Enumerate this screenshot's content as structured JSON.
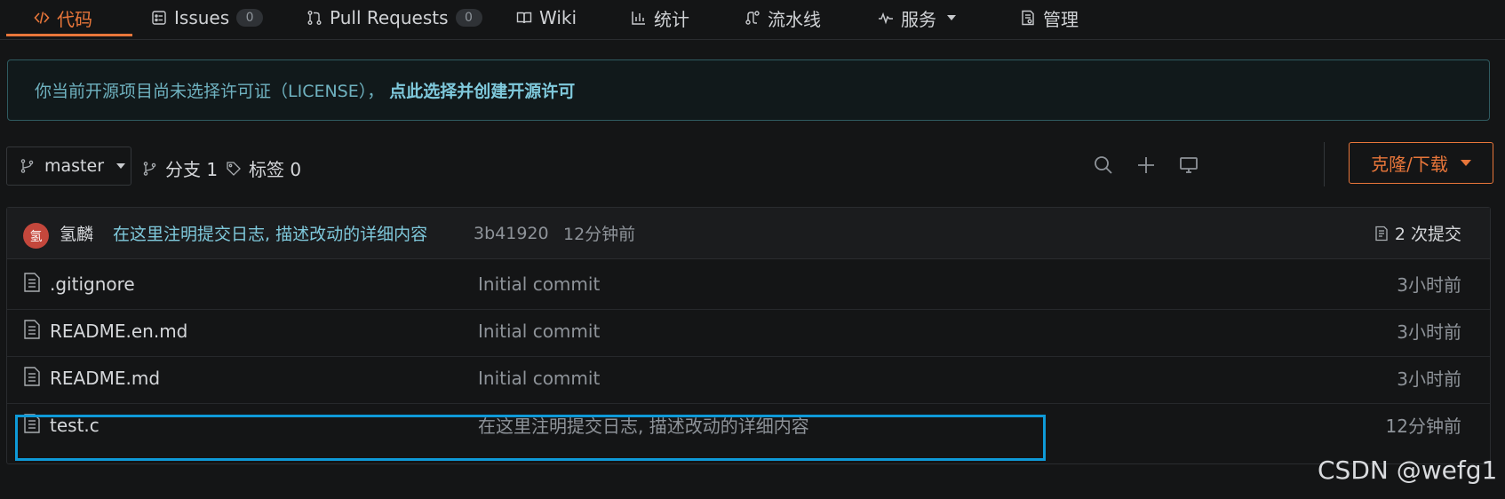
{
  "tabs": [
    {
      "label": "代码",
      "icon": "code-icon",
      "active": true
    },
    {
      "label": "Issues",
      "icon": "issue-icon",
      "count": "0"
    },
    {
      "label": "Pull Requests",
      "icon": "pull-request-icon",
      "count": "0"
    },
    {
      "label": "Wiki",
      "icon": "book-icon"
    },
    {
      "label": "统计",
      "icon": "chart-icon"
    },
    {
      "label": "流水线",
      "icon": "pipeline-icon"
    },
    {
      "label": "服务",
      "icon": "pulse-icon"
    },
    {
      "label": "管理",
      "icon": "settings-doc-icon"
    }
  ],
  "license": {
    "text": "你当前开源项目尚未选择许可证（LICENSE），",
    "link": "点此选择并创建开源许可"
  },
  "toolbar": {
    "branch": "master",
    "branches_label": "分支 1",
    "tags_label": "标签 0",
    "clone_label": "克隆/下载"
  },
  "commit": {
    "avatar_char": "氢",
    "author": "氢麟",
    "message": "在这里注明提交日志, 描述改动的详细内容",
    "sha": "3b41920",
    "time": "12分钟前",
    "commits_count": "2 次提交"
  },
  "files": [
    {
      "name": ".gitignore",
      "message": "Initial commit",
      "time": "3小时前"
    },
    {
      "name": "README.en.md",
      "message": "Initial commit",
      "time": "3小时前"
    },
    {
      "name": "README.md",
      "message": "Initial commit",
      "time": "3小时前"
    },
    {
      "name": "test.c",
      "message": "在这里注明提交日志, 描述改动的详细内容",
      "time": "12分钟前"
    }
  ],
  "watermark": "CSDN @wefg1",
  "colors": {
    "accent": "#e8763a",
    "link": "#7fc9dc",
    "highlight": "#0e9ad8"
  }
}
